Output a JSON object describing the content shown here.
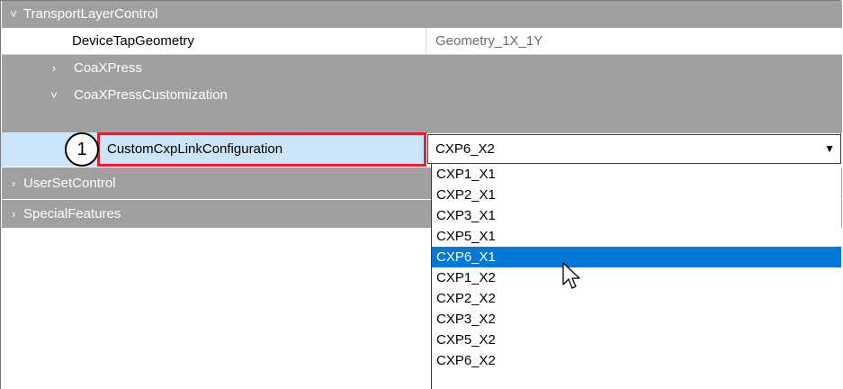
{
  "tree": {
    "transport_layer_control": {
      "chevron": "chevron-down",
      "label": "TransportLayerControl"
    },
    "device_tap_geometry": {
      "name": "DeviceTapGeometry",
      "value": "Geometry_1X_1Y"
    },
    "coaxpress": {
      "chevron": "chevron-right",
      "label": "CoaXPress"
    },
    "coaxpress_customization": {
      "chevron": "chevron-down",
      "label": "CoaXPressCustomization"
    },
    "custom_cxp": {
      "badge": "1",
      "name": "CustomCxpLinkConfiguration",
      "value": "CXP6_X2"
    },
    "user_set_control": {
      "chevron": "chevron-right",
      "label": "UserSetControl"
    },
    "special_features": {
      "chevron": "chevron-right",
      "label": "SpecialFeatures"
    }
  },
  "dropdown": {
    "selected": "CXP6_X1",
    "options": [
      "CXP1_X1",
      "CXP2_X1",
      "CXP3_X1",
      "CXP5_X1",
      "CXP6_X1",
      "CXP1_X2",
      "CXP2_X2",
      "CXP3_X2",
      "CXP5_X2",
      "CXP6_X2"
    ]
  },
  "colors": {
    "category_bg": "#a0a0a0",
    "selection_bg": "#cce4f7",
    "highlight": "#0078d7",
    "callout_border": "#e3212c"
  }
}
